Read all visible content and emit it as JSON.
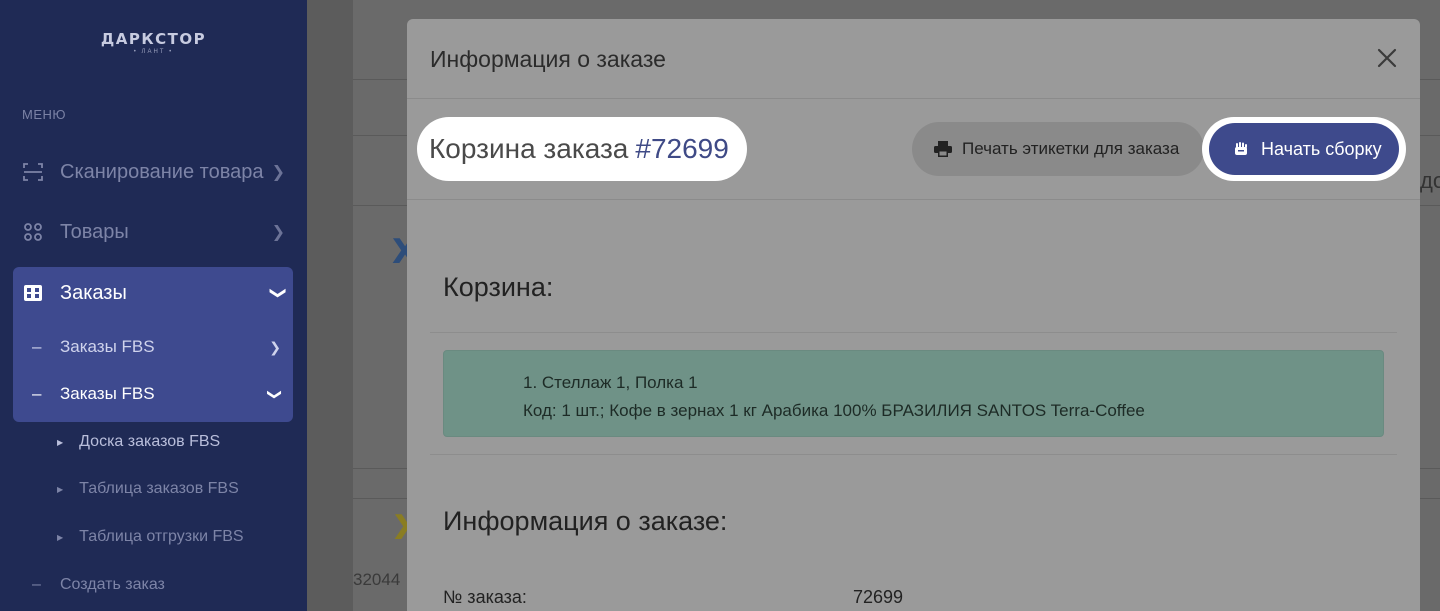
{
  "sidebar": {
    "logo": "ДАРКСТОР",
    "logo_sub": "• ЛАНТ •",
    "menu_caption": "МЕНЮ",
    "items": [
      {
        "label": "Сканирование товара",
        "icon": "scan-icon"
      },
      {
        "label": "Товары",
        "icon": "products-icon"
      },
      {
        "label": "Заказы",
        "icon": "orders-icon"
      }
    ],
    "sub_items": [
      {
        "label": "Заказы FBS"
      },
      {
        "label": "Заказы FBS"
      }
    ],
    "leaves": [
      {
        "label": "Доска заказов FBS"
      },
      {
        "label": "Таблица заказов FBS"
      },
      {
        "label": "Таблица отгрузки FBS"
      }
    ],
    "bottom_item": "Создать заказ"
  },
  "background": {
    "partial_text": "32044",
    "partial_right_text": "до"
  },
  "modal": {
    "title": "Информация о заказе",
    "cart_title_prefix": "Корзина заказа",
    "order_number": "#72699",
    "print_label": "Печать этикетки для заказа",
    "start_label": "Начать сборку",
    "cart_section": "Корзина:",
    "cart_line1": "1. Стеллаж 1, Полка 1",
    "cart_line2": "Код: 1 шт.; Кофе в зернах 1 кг Арабика 100% БРАЗИЛИЯ SANTOS Terra-Coffee",
    "info_section": "Информация о заказе:",
    "order_label": "№ заказа:",
    "order_value": "72699"
  },
  "colors": {
    "sidebar_bg": "#1f2a55",
    "active_group": "#3e4a8f",
    "primary_button": "#3e4a8c",
    "cart_box": "#6f9287"
  }
}
